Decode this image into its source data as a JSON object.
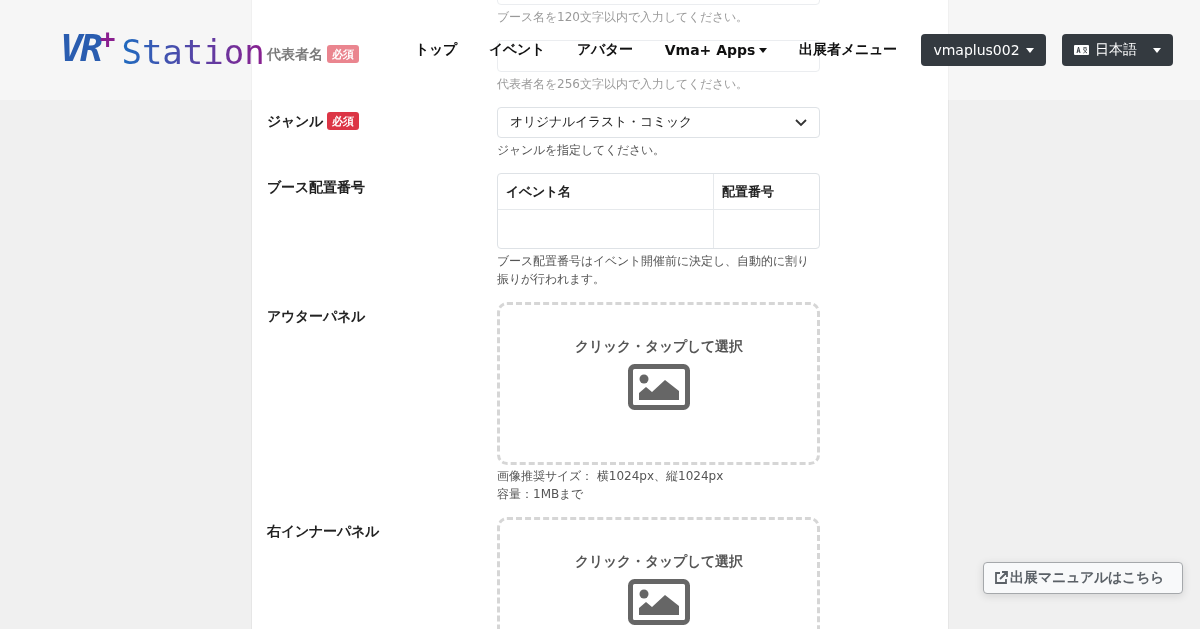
{
  "header": {
    "logo": {
      "mark": "VR",
      "plus": "+",
      "wordmark": "Station"
    },
    "nav": [
      {
        "label": "トップ",
        "kind": "link"
      },
      {
        "label": "イベント",
        "kind": "link"
      },
      {
        "label": "アバター",
        "kind": "link"
      },
      {
        "label": "Vma+ Apps",
        "kind": "dropdown"
      },
      {
        "label": "出展者メニュー",
        "kind": "link"
      }
    ],
    "account_button": {
      "label": "vmaplus002"
    },
    "language_button": {
      "label": "日本語"
    }
  },
  "form": {
    "fields": [
      {
        "kind": "text",
        "hint": "ブース名を120文字以内で入力してください。"
      },
      {
        "kind": "text",
        "label": "代表者名",
        "required": true,
        "badge": "必須",
        "hint": "代表者名を256文字以内で入力してください。"
      },
      {
        "kind": "select",
        "label": "ジャンル",
        "required": true,
        "badge": "必須",
        "value": "オリジナルイラスト・コミック",
        "hint": "ジャンルを指定してください。"
      },
      {
        "kind": "table",
        "label": "ブース配置番号",
        "required": false,
        "columns": [
          "イベント名",
          "配置番号"
        ],
        "hint": "ブース配置番号はイベント開催前に決定し、自動的に割り振りが行われます。"
      },
      {
        "kind": "image",
        "label": "アウターパネル",
        "required": false,
        "prompt": "クリック・タップして選択",
        "hints": [
          "画像推奨サイズ： 横1024px、縦1024px",
          "容量：1MBまで"
        ]
      },
      {
        "kind": "image",
        "label": "右インナーパネル",
        "required": false,
        "prompt": "クリック・タップして選択"
      }
    ]
  },
  "manual_button": {
    "label": "出展マニュアルはこちら"
  }
}
